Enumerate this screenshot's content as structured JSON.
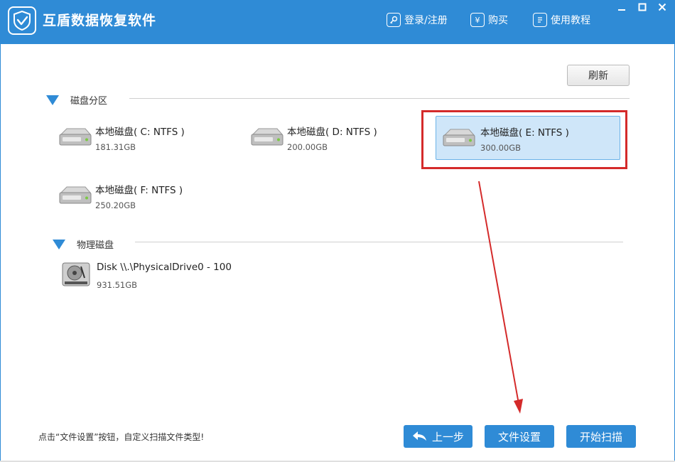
{
  "app": {
    "title": "互盾数据恢复软件"
  },
  "topnav": [
    {
      "label": "登录/注册",
      "icon": "key-icon"
    },
    {
      "label": "购买",
      "icon": "yen-icon"
    },
    {
      "label": "使用教程",
      "icon": "document-icon"
    }
  ],
  "window_controls": [
    "minimize",
    "maximize",
    "close"
  ],
  "toolbar": {
    "refresh_label": "刷新"
  },
  "sections": {
    "partitions": {
      "label": "磁盘分区"
    },
    "physical": {
      "label": "物理磁盘"
    }
  },
  "disks": [
    {
      "name": "本地磁盘( C: NTFS )",
      "size": "181.31GB",
      "selected": false
    },
    {
      "name": "本地磁盘( D: NTFS )",
      "size": "200.00GB",
      "selected": false
    },
    {
      "name": "本地磁盘( E: NTFS )",
      "size": "300.00GB",
      "selected": true
    },
    {
      "name": "本地磁盘( F: NTFS )",
      "size": "250.20GB",
      "selected": false
    }
  ],
  "physical_disks": [
    {
      "name": "Disk \\\\.\\PhysicalDrive0 - 100",
      "size": "931.51GB"
    }
  ],
  "footer": {
    "hint": "点击“文件设置”按钮，自定义扫描文件类型!",
    "back_label": "上一步",
    "file_settings_label": "文件设置",
    "start_scan_label": "开始扫描"
  },
  "colors": {
    "accent": "#2f8bd6",
    "selection": "#cfe6f9",
    "annotation": "#d42a2a"
  }
}
